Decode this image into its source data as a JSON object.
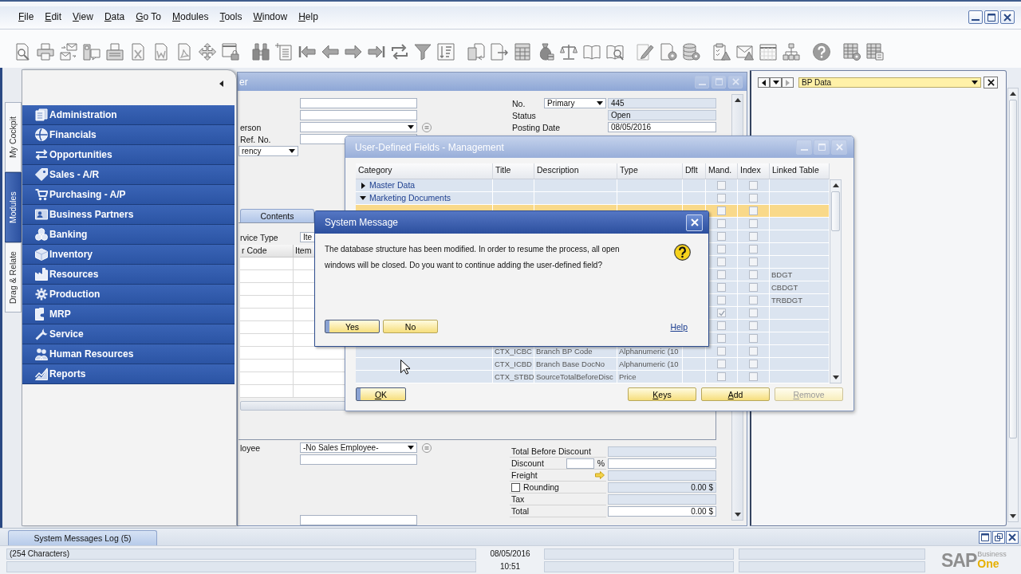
{
  "menu": [
    "File",
    "Edit",
    "View",
    "Data",
    "Go To",
    "Modules",
    "Tools",
    "Window",
    "Help"
  ],
  "side_tabs": [
    {
      "label": "My Cockpit",
      "selected": false
    },
    {
      "label": "Modules",
      "selected": true
    },
    {
      "label": "Drag & Relate",
      "selected": false
    }
  ],
  "modules_panel": {
    "items": [
      "Administration",
      "Financials",
      "Opportunities",
      "Sales - A/R",
      "Purchasing - A/P",
      "Business Partners",
      "Banking",
      "Inventory",
      "Resources",
      "Production",
      "MRP",
      "Service",
      "Human Resources",
      "Reports"
    ]
  },
  "document_window": {
    "title": "er",
    "header_left": [
      {
        "kind": "text"
      },
      {
        "kind": "text"
      },
      {
        "kind": "dropdown",
        "label": "erson"
      },
      {
        "kind": "text",
        "label": "Ref. No."
      },
      {
        "kind": "select",
        "value": "rency"
      }
    ],
    "header_right": [
      {
        "label": "No.",
        "series": "Primary",
        "value": "445",
        "editable": false
      },
      {
        "label": "Status",
        "value": "Open",
        "editable": false
      },
      {
        "label": "Posting Date",
        "value": "08/05/2016",
        "editable": true
      }
    ],
    "tabs": [
      {
        "label": "Contents",
        "selected": true
      }
    ],
    "service_type": {
      "label": "rvice Type",
      "value": "Ite"
    },
    "grid": {
      "columns": [
        "r Code",
        "Item"
      ]
    },
    "footer_left": [
      {
        "kind": "dropdown",
        "label": "loyee",
        "value": "-No Sales Employee-"
      },
      {
        "kind": "text"
      },
      {
        "kind": "text"
      }
    ],
    "totals": [
      {
        "kind": "plain",
        "label": "Total Before Discount",
        "editable": false
      },
      {
        "kind": "percent",
        "label": "Discount",
        "unit": "%",
        "editable": true
      },
      {
        "kind": "freight",
        "label": "Freight",
        "editable": false
      },
      {
        "kind": "checkbox",
        "label": "Rounding",
        "checked": false,
        "value": "0.00 $",
        "editable": false
      },
      {
        "kind": "plain",
        "label": "Tax",
        "editable": false
      },
      {
        "kind": "plain",
        "label": "Total",
        "value": "0.00 $",
        "editable": true
      }
    ]
  },
  "right_panel": {
    "selector": "BP Data"
  },
  "udf_window": {
    "title": "User-Defined Fields - Management",
    "columns": [
      "Category",
      "Title",
      "Description",
      "Type",
      "Dflt",
      "Mand.",
      "Index",
      "Linked Table"
    ],
    "rows": [
      {
        "category": "Master Data",
        "expanded": false,
        "selected": false,
        "mandatory": false,
        "indexed": false
      },
      {
        "category": "Marketing Documents",
        "expanded": true,
        "selected": false,
        "mandatory": false,
        "indexed": false,
        "children": [
          {
            "selected": true,
            "mandatory": false,
            "indexed": false
          },
          {
            "selected": false,
            "mandatory": false,
            "indexed": false
          },
          {
            "selected": false,
            "mandatory": false,
            "indexed": false
          },
          {
            "selected": false,
            "mandatory": false,
            "indexed": false
          },
          {
            "selected": false,
            "mandatory": false,
            "indexed": false
          },
          {
            "selected": false,
            "mandatory": false,
            "indexed": false,
            "linked_table": "BDGT"
          },
          {
            "selected": false,
            "mandatory": false,
            "indexed": false,
            "linked_table": "CBDGT"
          },
          {
            "selected": false,
            "mandatory": false,
            "indexed": false,
            "linked_table": "TRBDGT"
          },
          {
            "selected": false,
            "mandatory": true,
            "indexed": false
          },
          {
            "selected": false,
            "mandatory": false,
            "indexed": false
          },
          {
            "selected": false,
            "mandatory": false,
            "indexed": false
          },
          {
            "selected": false,
            "mandatory": false,
            "indexed": false,
            "title": "CTX_ICBC",
            "description": "Branch BP Code",
            "type": "Alphanumeric (10"
          },
          {
            "selected": false,
            "mandatory": false,
            "indexed": false,
            "title": "CTX_ICBD",
            "description": "Branch Base DocNo",
            "type": "Alphanumeric (10"
          },
          {
            "selected": false,
            "mandatory": false,
            "indexed": false,
            "title": "CTX_STBD",
            "description": "SourceTotalBeforeDisc",
            "type": "Price"
          }
        ]
      }
    ],
    "buttons": [
      {
        "label": "OK",
        "default": true,
        "disabled": false
      },
      {
        "label": "Keys",
        "default": false,
        "disabled": false
      },
      {
        "label": "Add",
        "default": false,
        "disabled": false
      },
      {
        "label": "Remove",
        "default": false,
        "disabled": true
      }
    ]
  },
  "system_message": {
    "title": "System Message",
    "text": "The database structure has been modified. In order to resume the process, all open windows will be closed. Do you want to continue adding the user-defined field?",
    "buttons": [
      {
        "label": "Yes",
        "default": true
      },
      {
        "label": "No",
        "default": false
      }
    ],
    "help_link": "Help"
  },
  "log_bar": {
    "tab": "System Messages Log (5)"
  },
  "status_bar": {
    "message": "(254 Characters)",
    "date": "08/05/2016",
    "time": "10:51"
  },
  "logo": {
    "mark": "SAP",
    "line1": "Business",
    "line2": "One"
  }
}
